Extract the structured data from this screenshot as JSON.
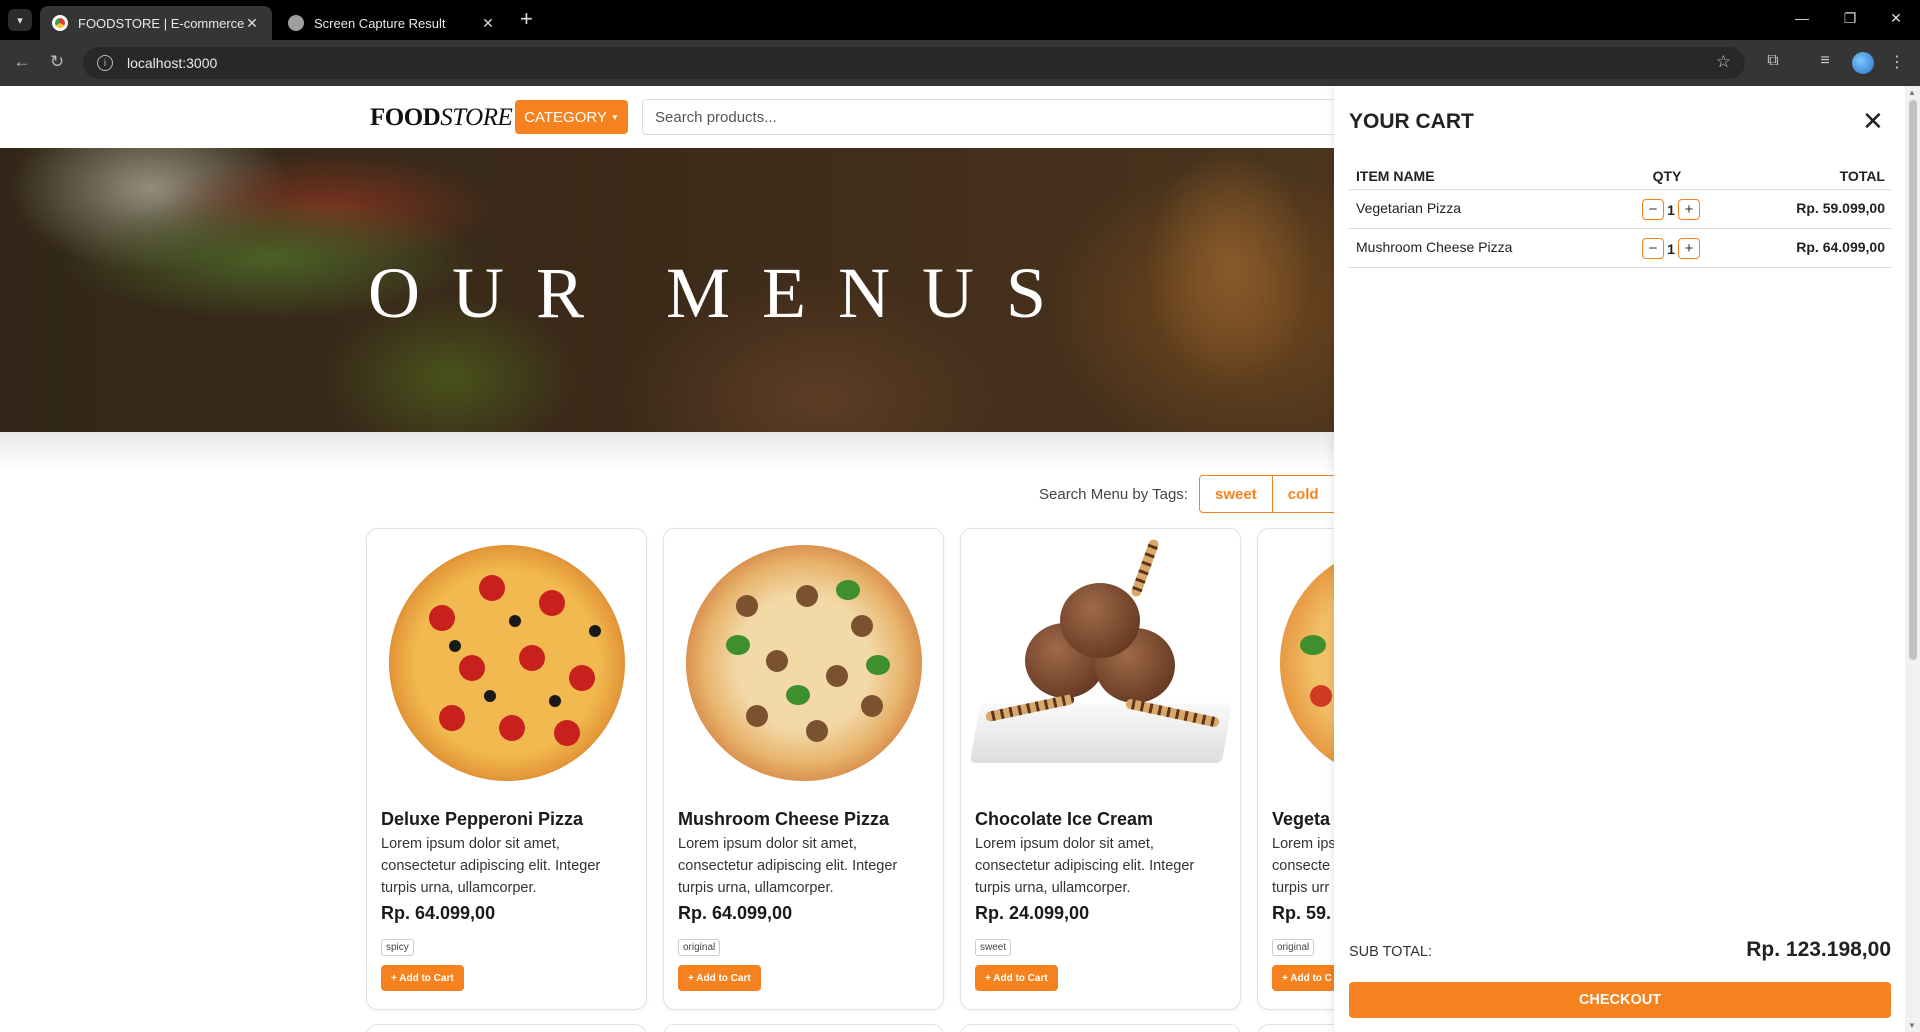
{
  "browser": {
    "tabs": [
      {
        "title": "FOODSTORE | E-commerce App",
        "active": true
      },
      {
        "title": "Screen Capture Result",
        "active": false
      }
    ],
    "url": "localhost:3000"
  },
  "navbar": {
    "logo_bold": "FOOD",
    "logo_italic": "STORE",
    "category_label": "CATEGORY",
    "search_placeholder": "Search products..."
  },
  "hero": {
    "title": "OUR MENUS"
  },
  "tags": {
    "label": "Search Menu by Tags:",
    "items": [
      "sweet",
      "cold"
    ]
  },
  "products": [
    {
      "name": "Deluxe Pepperoni Pizza",
      "description": "Lorem ipsum dolor sit amet, consectetur adipiscing elit. Integer turpis urna, ullamcorper.",
      "price": "Rp. 64.099,00",
      "tag": "spicy",
      "add_label": "+ Add to Cart"
    },
    {
      "name": "Mushroom Cheese Pizza",
      "description": "Lorem ipsum dolor sit amet, consectetur adipiscing elit. Integer turpis urna, ullamcorper.",
      "price": "Rp. 64.099,00",
      "tag": "original",
      "add_label": "+ Add to Cart"
    },
    {
      "name": "Chocolate Ice Cream",
      "description": "Lorem ipsum dolor sit amet, consectetur adipiscing elit. Integer turpis urna, ullamcorper.",
      "price": "Rp. 24.099,00",
      "tag": "sweet",
      "add_label": "+ Add to Cart"
    },
    {
      "name": "Vegeta",
      "description": "Lorem ips consecte turpis urr",
      "price": "Rp. 59.",
      "tag": "original",
      "add_label": "+ Add to C"
    }
  ],
  "cart": {
    "title": "YOUR CART",
    "columns": {
      "name": "ITEM NAME",
      "qty": "QTY",
      "total": "TOTAL"
    },
    "items": [
      {
        "name": "Vegetarian Pizza",
        "qty": "1",
        "total": "Rp. 59.099,00"
      },
      {
        "name": "Mushroom Cheese Pizza",
        "qty": "1",
        "total": "Rp. 64.099,00"
      }
    ],
    "subtotal_label": "SUB TOTAL:",
    "subtotal_value": "Rp. 123.198,00",
    "checkout_label": "CHECKOUT"
  },
  "colors": {
    "accent": "#f5821f",
    "chrome_bg": "#000000",
    "toolbar_bg": "#353535"
  }
}
